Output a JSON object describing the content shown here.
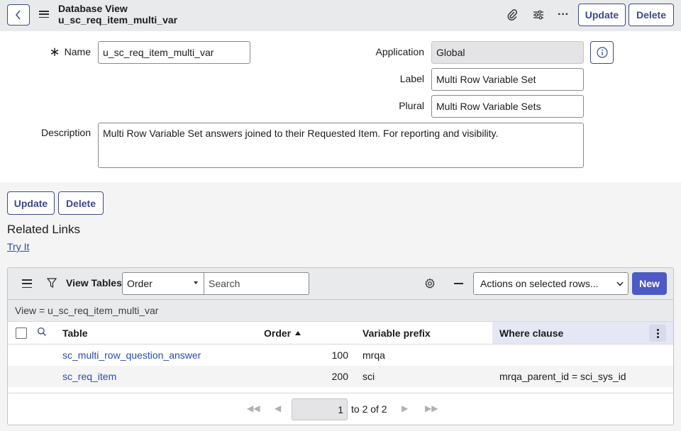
{
  "header": {
    "title": "Database View",
    "subtitle": "u_sc_req_item_multi_var",
    "update_label": "Update",
    "delete_label": "Delete"
  },
  "form": {
    "name_label": "Name",
    "name_value": "u_sc_req_item_multi_var",
    "application_label": "Application",
    "application_value": "Global",
    "label_label": "Label",
    "label_value": "Multi Row Variable Set",
    "plural_label": "Plural",
    "plural_value": "Multi Row Variable Sets",
    "description_label": "Description",
    "description_value": "Multi Row Variable Set answers joined to their Requested Item. For reporting and visibility."
  },
  "bottom_buttons": {
    "update_label": "Update",
    "delete_label": "Delete"
  },
  "related_links": {
    "title": "Related Links",
    "try_it": "Try It"
  },
  "list": {
    "title": "View Tables",
    "search_field_selected": "Order",
    "search_placeholder": "Search",
    "actions_selected": "Actions on selected rows...",
    "new_label": "New",
    "breadcrumb": "View = u_sc_req_item_multi_var",
    "columns": {
      "table": "Table",
      "order": "Order",
      "prefix": "Variable prefix",
      "where": "Where clause"
    },
    "rows": [
      {
        "table": "sc_multi_row_question_answer",
        "order": "100",
        "prefix": "mrqa",
        "where": ""
      },
      {
        "table": "sc_req_item",
        "order": "200",
        "prefix": "sci",
        "where": "mrqa_parent_id = sci_sys_id"
      }
    ],
    "pager": {
      "current": "1",
      "range_text": "to 2 of 2"
    }
  },
  "colors": {
    "accent": "#3c4a8a",
    "new_button": "#4d59c4",
    "link": "#2a4cb4",
    "header_bg": "#e9eaec",
    "sorted_col_bg": "#e6e7f4"
  }
}
